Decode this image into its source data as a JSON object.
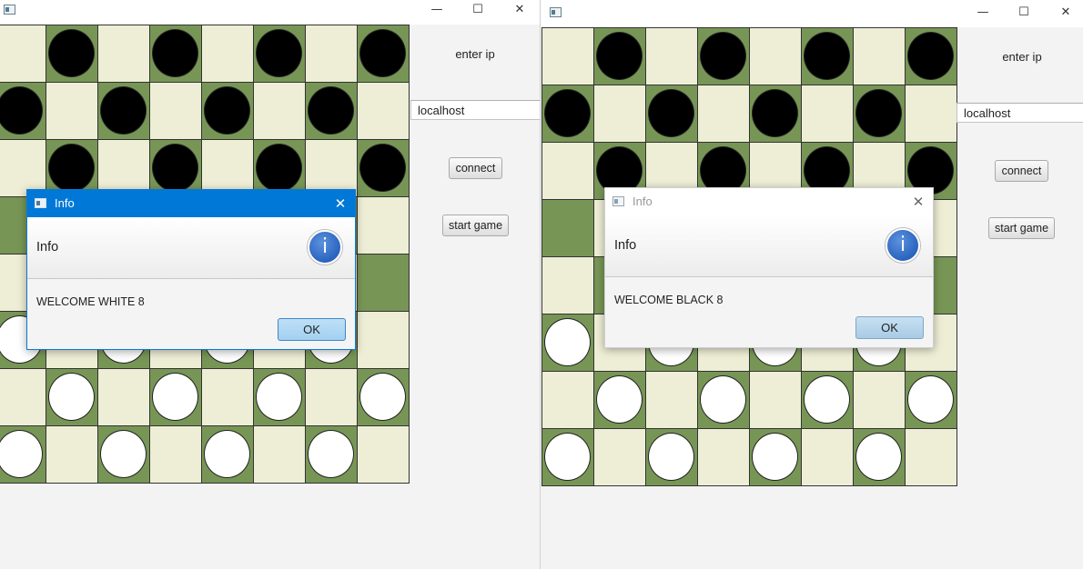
{
  "windows": [
    {
      "id": "left",
      "controls": {
        "minimize": "—",
        "maximize": "☐",
        "close": "✕"
      },
      "side_panel": {
        "ip_label": "enter ip",
        "ip_value": "localhost",
        "connect_label": "connect",
        "start_label": "start game"
      },
      "board": {
        "rows": [
          "-b-b-b-b",
          "b-b-b-b-",
          "-b-b-b-b",
          "--------",
          "--------",
          "w-w-w-w-",
          "-w-w-w-w",
          "w-w-w-w-"
        ]
      },
      "dialog": {
        "title": "Info",
        "header": "Info",
        "message": "WELCOME WHITE 8",
        "ok_label": "OK",
        "close": "✕",
        "info_glyph": "i",
        "focused": true
      }
    },
    {
      "id": "right",
      "controls": {
        "minimize": "—",
        "maximize": "☐",
        "close": "✕"
      },
      "side_panel": {
        "ip_label": "enter ip",
        "ip_value": "localhost",
        "connect_label": "connect",
        "start_label": "start game"
      },
      "board": {
        "rows": [
          "-b-b-b-b",
          "b-b-b-b-",
          "-b-b-b-b",
          "--------",
          "--------",
          "w-w-w-w-",
          "-w-w-w-w",
          "w-w-w-w-"
        ]
      },
      "dialog": {
        "title": "Info",
        "header": "Info",
        "message": "WELCOME BLACK 8",
        "ok_label": "OK",
        "close": "✕",
        "info_glyph": "i",
        "focused": false
      }
    }
  ],
  "colors": {
    "light_square": "#eeeed6",
    "dark_square": "#779656",
    "black_piece": "#000000",
    "white_piece": "#ffffff",
    "dialog_title_active": "#0078d7",
    "ok_button": "#a3d0f0"
  }
}
